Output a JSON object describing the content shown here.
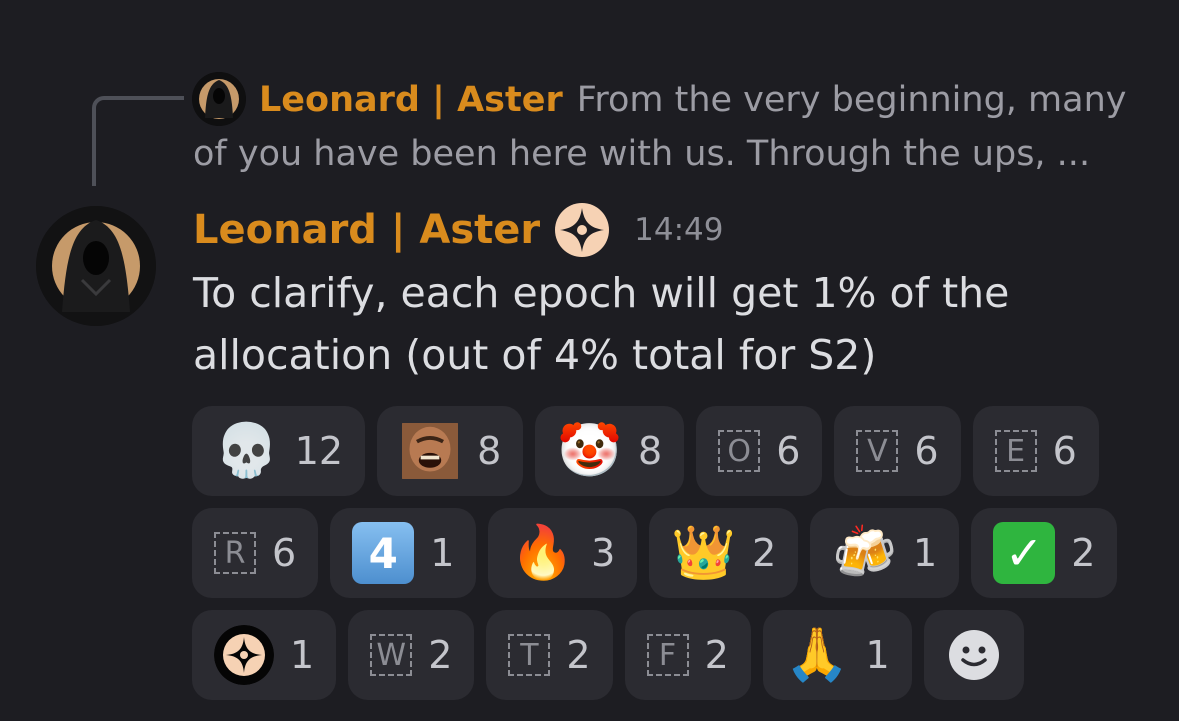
{
  "reply": {
    "author": "Leonard | Aster",
    "preview": "From the very beginning, many of you have been here with us. Through the ups, ..."
  },
  "message": {
    "author": "Leonard | Aster",
    "timestamp": "14:49",
    "content": "To clarify, each epoch will get 1% of the allocation (out of 4% total for S2)"
  },
  "reactions": [
    {
      "icon": "skull-emoji",
      "glyph": "💀",
      "count": "12"
    },
    {
      "icon": "laughing-man-custom-emoji",
      "count": "8"
    },
    {
      "icon": "clown-face-emoji",
      "glyph": "🤡",
      "count": "8"
    },
    {
      "icon": "letter-o-emoji",
      "letter": "O",
      "count": "6"
    },
    {
      "icon": "letter-v-emoji",
      "letter": "V",
      "count": "6"
    },
    {
      "icon": "letter-e-emoji",
      "letter": "E",
      "count": "6"
    },
    {
      "icon": "letter-r-emoji",
      "letter": "R",
      "count": "6"
    },
    {
      "icon": "keycap-4-emoji",
      "glyph": "4",
      "count": "1"
    },
    {
      "icon": "fire-emoji",
      "glyph": "🔥",
      "count": "3"
    },
    {
      "icon": "crown-emoji",
      "glyph": "👑",
      "count": "2"
    },
    {
      "icon": "beer-mugs-emoji",
      "glyph": "🍻",
      "count": "1"
    },
    {
      "icon": "check-mark-emoji",
      "glyph": "✓",
      "count": "2"
    },
    {
      "icon": "aster-logo-custom-emoji",
      "count": "1"
    },
    {
      "icon": "letter-w-emoji",
      "letter": "W",
      "count": "2"
    },
    {
      "icon": "letter-t-emoji",
      "letter": "T",
      "count": "2"
    },
    {
      "icon": "letter-f-emoji",
      "letter": "F",
      "count": "2"
    },
    {
      "icon": "folded-hands-emoji",
      "glyph": "🙏",
      "count": "1"
    }
  ],
  "add_reaction": {
    "icon": "smiley-add-reaction-icon"
  },
  "colors": {
    "author": "#d98b1d",
    "background": "#1d1d22",
    "reaction_bg": "#2b2b31"
  }
}
